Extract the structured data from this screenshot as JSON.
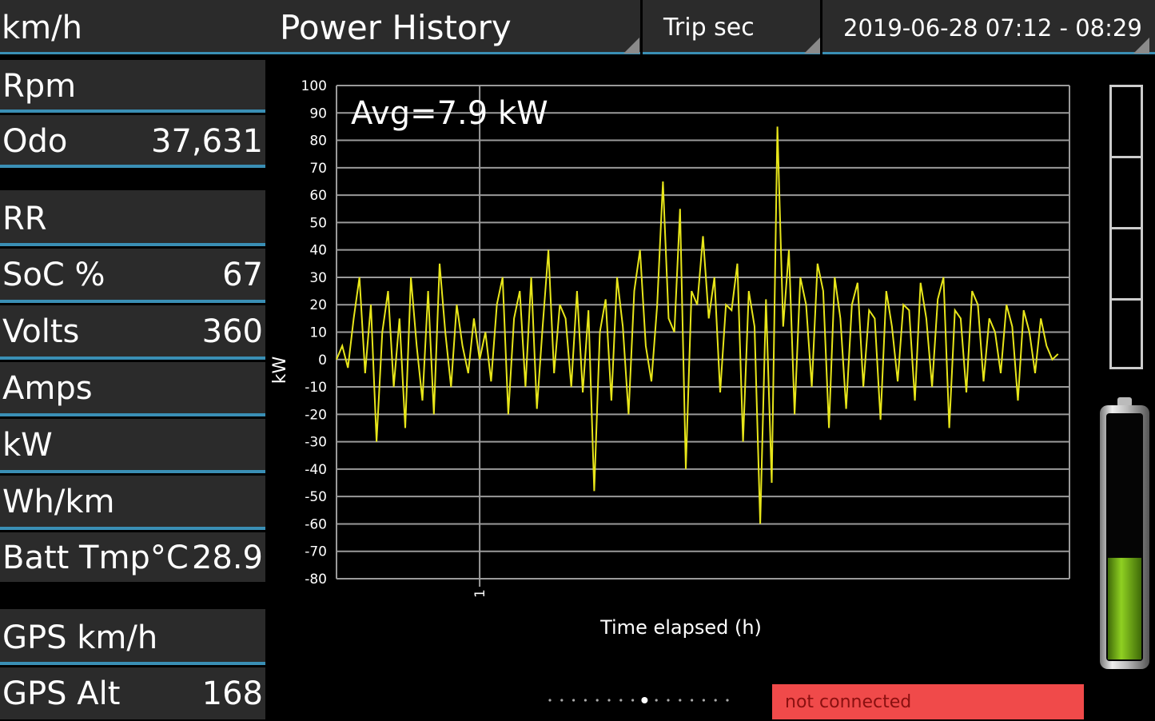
{
  "header": {
    "speed_unit": "km/h",
    "title": "Power History",
    "mode_selector": "Trip sec",
    "date_range": "2019-06-28 07:12 - 08:29"
  },
  "readouts": [
    {
      "label": "Rpm",
      "value": ""
    },
    {
      "label": "Odo",
      "value": "37,631"
    },
    {
      "label": "RR",
      "value": ""
    },
    {
      "label": "SoC %",
      "value": "67"
    },
    {
      "label": "Volts",
      "value": "360"
    },
    {
      "label": "Amps",
      "value": ""
    },
    {
      "label": "kW",
      "value": ""
    },
    {
      "label": "Wh/km",
      "value": ""
    },
    {
      "label": "Batt Tmp°C",
      "value": "28.9"
    },
    {
      "label": "GPS km/h",
      "value": ""
    },
    {
      "label": "GPS Alt",
      "value": "168"
    }
  ],
  "status": {
    "connection": "not connected"
  },
  "pager": {
    "count": 16,
    "active_index": 8
  },
  "battery": {
    "level_percent": 67,
    "fill_color": "#7fbf1a"
  },
  "chart_data": {
    "type": "line",
    "annotation": "Avg=7.9 kW",
    "xlabel": "Time elapsed (h)",
    "ylabel": "kW",
    "ylim": [
      -80,
      100
    ],
    "yticks": [
      100,
      90,
      80,
      70,
      60,
      50,
      40,
      30,
      20,
      10,
      0,
      -10,
      -20,
      -30,
      -40,
      -50,
      -60,
      -70,
      -80
    ],
    "x_tick_labels": [
      "1"
    ],
    "x_tick_positions_h": [
      0.25
    ],
    "xlim_h": [
      0,
      1.28
    ],
    "grid": true,
    "series": [
      {
        "color": "#e8e61a",
        "x_h": [
          0.0,
          0.01,
          0.02,
          0.03,
          0.04,
          0.05,
          0.06,
          0.07,
          0.08,
          0.09,
          0.1,
          0.11,
          0.12,
          0.13,
          0.14,
          0.15,
          0.16,
          0.17,
          0.18,
          0.19,
          0.2,
          0.21,
          0.22,
          0.23,
          0.24,
          0.25,
          0.26,
          0.27,
          0.28,
          0.29,
          0.3,
          0.31,
          0.32,
          0.33,
          0.34,
          0.35,
          0.36,
          0.37,
          0.38,
          0.39,
          0.4,
          0.41,
          0.42,
          0.43,
          0.44,
          0.45,
          0.46,
          0.47,
          0.48,
          0.49,
          0.5,
          0.51,
          0.52,
          0.53,
          0.54,
          0.55,
          0.56,
          0.57,
          0.58,
          0.59,
          0.6,
          0.61,
          0.62,
          0.63,
          0.64,
          0.65,
          0.66,
          0.67,
          0.68,
          0.69,
          0.7,
          0.71,
          0.72,
          0.73,
          0.74,
          0.75,
          0.76,
          0.77,
          0.78,
          0.79,
          0.8,
          0.81,
          0.82,
          0.83,
          0.84,
          0.85,
          0.86,
          0.87,
          0.88,
          0.89,
          0.9,
          0.91,
          0.92,
          0.93,
          0.94,
          0.95,
          0.96,
          0.97,
          0.98,
          0.99,
          1.0,
          1.01,
          1.02,
          1.03,
          1.04,
          1.05,
          1.06,
          1.07,
          1.08,
          1.09,
          1.1,
          1.11,
          1.12,
          1.13,
          1.14,
          1.15,
          1.16,
          1.17,
          1.18,
          1.19,
          1.2,
          1.21,
          1.22,
          1.23,
          1.24,
          1.25,
          1.26,
          1.27
        ],
        "y_kw": [
          0,
          5,
          -3,
          15,
          30,
          -5,
          20,
          -30,
          10,
          25,
          -10,
          15,
          -25,
          30,
          5,
          -15,
          25,
          -20,
          35,
          10,
          -10,
          20,
          5,
          -5,
          15,
          0,
          10,
          -8,
          20,
          30,
          -20,
          15,
          25,
          -10,
          30,
          -18,
          12,
          40,
          -5,
          20,
          15,
          -10,
          25,
          -12,
          18,
          -48,
          10,
          22,
          -15,
          30,
          12,
          -20,
          25,
          40,
          5,
          -8,
          20,
          65,
          15,
          10,
          55,
          -40,
          25,
          20,
          45,
          15,
          30,
          -12,
          20,
          18,
          35,
          -30,
          25,
          12,
          -60,
          22,
          -45,
          85,
          12,
          40,
          -20,
          30,
          20,
          -10,
          35,
          25,
          -25,
          30,
          15,
          -18,
          20,
          28,
          -10,
          18,
          15,
          -22,
          25,
          12,
          -8,
          20,
          18,
          -15,
          28,
          15,
          -10,
          22,
          30,
          -25,
          18,
          15,
          -12,
          25,
          20,
          -8,
          15,
          10,
          -5,
          20,
          12,
          -15,
          18,
          10,
          -5,
          15,
          5,
          0,
          2
        ]
      }
    ]
  }
}
